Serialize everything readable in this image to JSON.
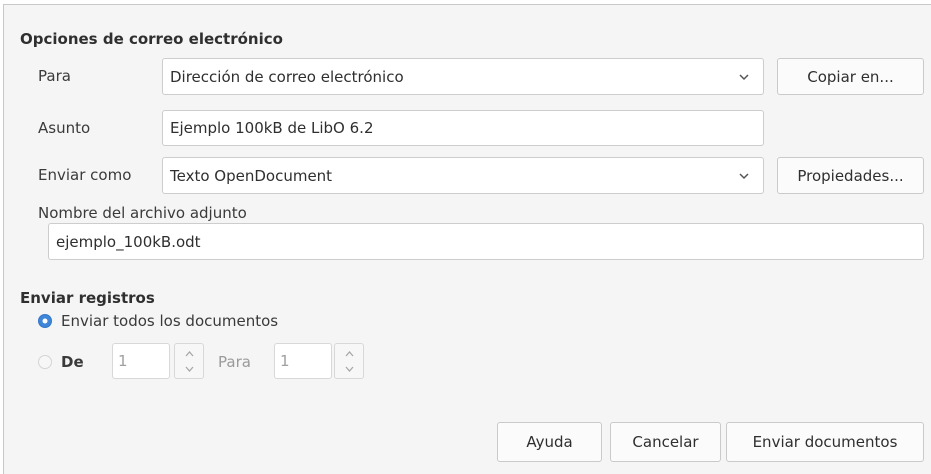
{
  "email_options": {
    "section_title": "Opciones de correo electrónico",
    "to_label": "Para",
    "to_value": "Dirección de correo electrónico",
    "copy_to_button": "Copiar en...",
    "subject_label": "Asunto",
    "subject_value": "Ejemplo 100kB de LibO 6.2",
    "send_as_label": "Enviar como",
    "send_as_value": "Texto OpenDocument",
    "properties_button": "Propiedades...",
    "attachment_label": "Nombre del archivo adjunto",
    "attachment_value": "ejemplo_100kB.odt"
  },
  "send_records": {
    "section_title": "Enviar registros",
    "all_documents_label": "Enviar todos los documentos",
    "all_documents_selected": true,
    "from_label": "De",
    "from_value": "1",
    "to_label": "Para",
    "to_value": "1"
  },
  "footer": {
    "help_button": "Ayuda",
    "cancel_button": "Cancelar",
    "send_button": "Enviar documentos"
  },
  "colors": {
    "radio_selected": "#3f86d8",
    "dialog_background": "#f5f5f5"
  },
  "icons": {
    "dropdown": "chevron-down-icon",
    "spin_up": "chevron-up-icon",
    "spin_down": "chevron-down-icon"
  }
}
